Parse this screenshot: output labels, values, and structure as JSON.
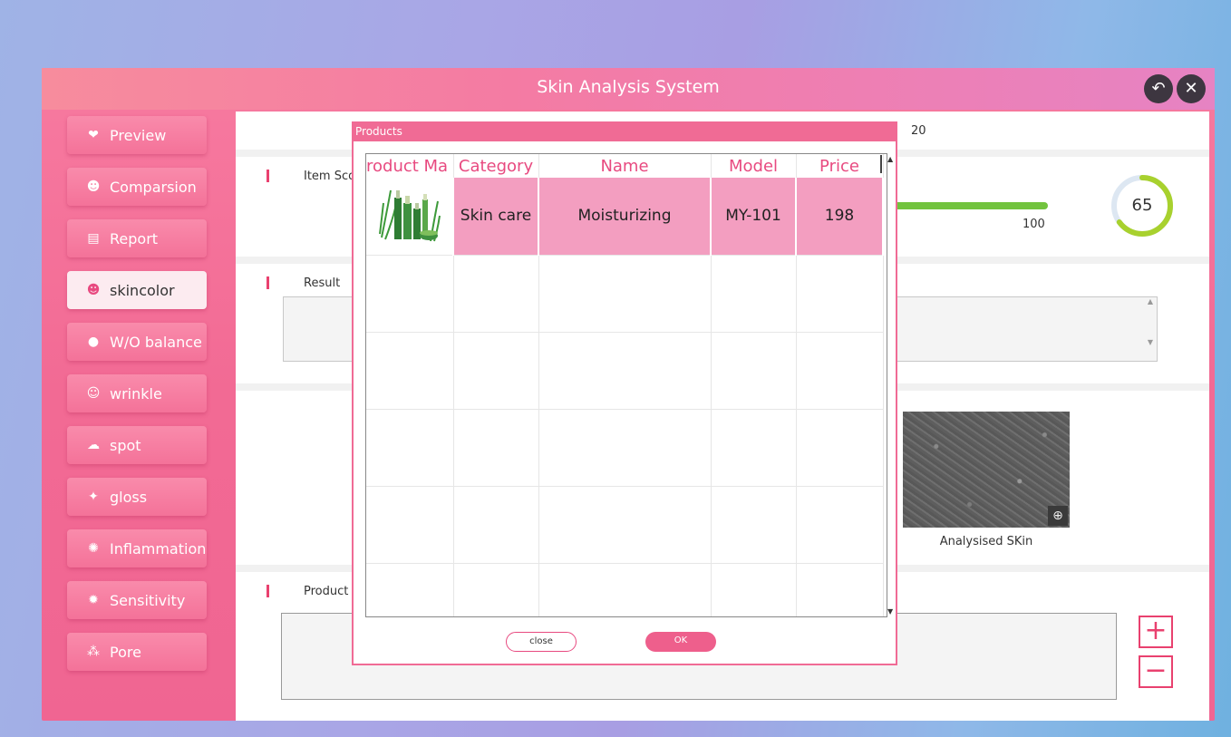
{
  "app": {
    "title": "Skin Analysis System",
    "back_icon": "back-arrow-icon",
    "close_icon": "close-icon"
  },
  "sidebar": {
    "items": [
      {
        "label": "Preview",
        "icon": "face-icon"
      },
      {
        "label": "Comparsion",
        "icon": "face-icon"
      },
      {
        "label": "Report",
        "icon": "report-icon"
      },
      {
        "label": "skincolor",
        "icon": "face-icon",
        "active": true
      },
      {
        "label": "W/O balance",
        "icon": "drop-icon"
      },
      {
        "label": "wrinkle",
        "icon": "wrinkle-icon"
      },
      {
        "label": "spot",
        "icon": "spot-icon"
      },
      {
        "label": "gloss",
        "icon": "sparkle-icon"
      },
      {
        "label": "Inflammation",
        "icon": "inflammation-icon"
      },
      {
        "label": "Sensitivity",
        "icon": "sensitivity-icon"
      },
      {
        "label": "Pore",
        "icon": "pore-icon"
      }
    ]
  },
  "main": {
    "top_value": "20",
    "item_score_label": "Item Sco",
    "score_max": "100",
    "score": "65",
    "score_fraction": 0.65,
    "result_label": "Result",
    "analysed_caption": "Analysised SKin",
    "products_label": "Product",
    "plus": "+",
    "minus": "−"
  },
  "dialog": {
    "title": "Products",
    "columns": [
      "roduct Ma",
      "Category",
      "Name",
      "Model",
      "Price"
    ],
    "rows": [
      {
        "image": "product-image",
        "category": "Skin care",
        "name": "Moisturizing",
        "model": "MY-101",
        "price": "198"
      }
    ],
    "close_label": "close",
    "ok_label": "OK"
  },
  "colors": {
    "accent": "#f06b95",
    "score_ring": "#a8d12e",
    "score_bar": "#72c33e"
  }
}
